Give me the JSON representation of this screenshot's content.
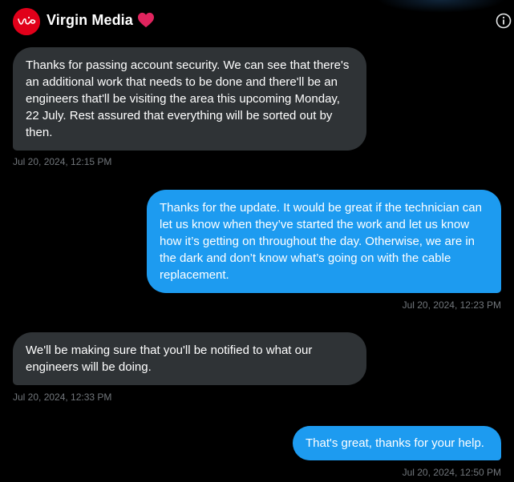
{
  "header": {
    "title": "Virgin Media",
    "avatar_icon": "virgin-logo",
    "badge_icon": "heart-icon",
    "info_icon": "info-icon",
    "accent": "#e1001a"
  },
  "colors": {
    "incoming_bubble": "#2f3336",
    "outgoing_bubble": "#1d9bf0",
    "timestamp": "#71767b"
  },
  "messages": [
    {
      "direction": "incoming",
      "text": "Thanks for passing account security. We can see that there's an additional work that needs to be done and there'll be an engineers that'll be visiting the area this upcoming Monday, 22 July. Rest assured that everything will be sorted out by then.",
      "time": "Jul 20, 2024, 12:15 PM"
    },
    {
      "direction": "outgoing",
      "text": "Thanks for the update. It would be great if the technician can let us know when they’ve started the work and let us know how it’s getting on throughout the day. Otherwise, we are in the dark and don’t know what’s going on with the cable replacement.",
      "time": "Jul 20, 2024, 12:23 PM"
    },
    {
      "direction": "incoming",
      "text": "We'll be making sure that you'll be notified to what our engineers will be doing.",
      "time": "Jul 20, 2024, 12:33 PM"
    },
    {
      "direction": "outgoing",
      "text": "That's great, thanks for your help.",
      "time": "Jul 20, 2024, 12:50 PM"
    }
  ]
}
